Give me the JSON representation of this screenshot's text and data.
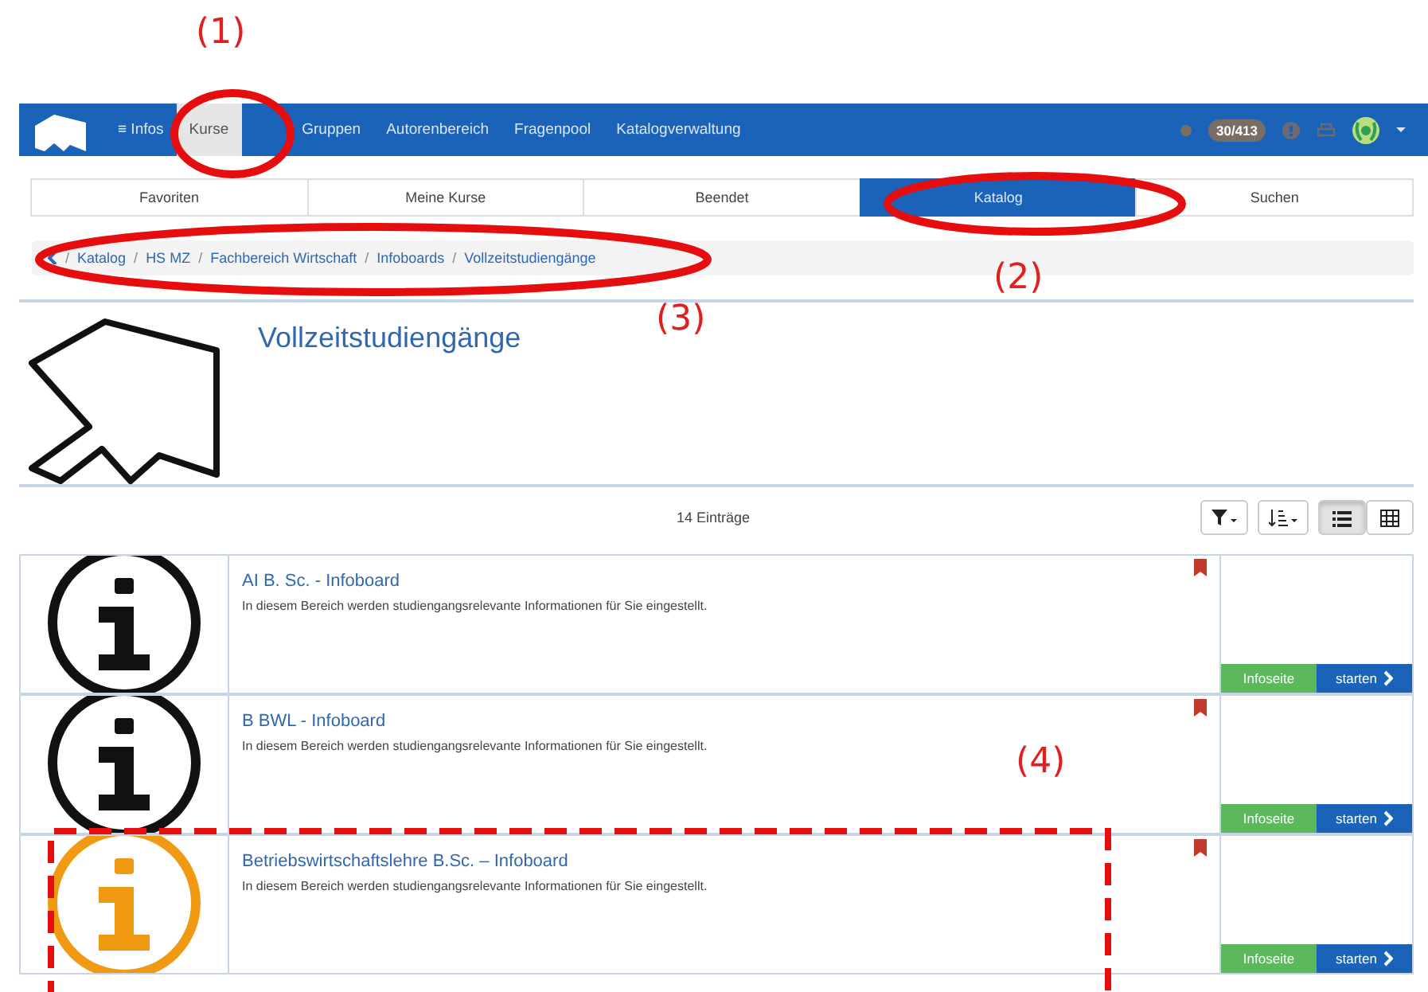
{
  "nav": {
    "items": [
      {
        "label": "≡ Infos",
        "selected": false
      },
      {
        "label": "Kurse",
        "selected": true
      },
      {
        "label": "Gruppen",
        "selected": false
      },
      {
        "label": "Autorenbereich",
        "selected": false
      },
      {
        "label": "Fragenpool",
        "selected": false
      },
      {
        "label": "Katalogverwaltung",
        "selected": false
      }
    ],
    "badge": "30/413"
  },
  "tabs": [
    {
      "label": "Favoriten",
      "selected": false
    },
    {
      "label": "Meine Kurse",
      "selected": false
    },
    {
      "label": "Beendet",
      "selected": false
    },
    {
      "label": "Katalog",
      "selected": true
    },
    {
      "label": "Suchen",
      "selected": false
    }
  ],
  "breadcrumb": [
    "Katalog",
    "HS MZ",
    "Fachbereich Wirtschaft",
    "Infoboards",
    "Vollzeitstudiengänge"
  ],
  "breadcrumb_separator": "/",
  "title": "Vollzeitstudiengänge",
  "count": "14 Einträge",
  "views": [
    {
      "kind": "list",
      "selected": true
    },
    {
      "kind": "table",
      "selected": false
    }
  ],
  "cards": [
    {
      "title": "AI B. Sc. - Infoboard",
      "description": "In diesem Bereich werden studiengangsrelevante Informationen für Sie eingestellt.",
      "color": "#111111",
      "info_button": "Infoseite",
      "start_button": "starten"
    },
    {
      "title": "B BWL - Infoboard",
      "description": "In diesem Bereich werden studiengangsrelevante Informationen für Sie eingestellt.",
      "color": "#111111",
      "info_button": "Infoseite",
      "start_button": "starten"
    },
    {
      "title": "Betriebswirtschaftslehre B.Sc. – Infoboard",
      "description": "In diesem Bereich werden studiengangsrelevante Informationen für Sie eingestellt.",
      "color": "#f09a13",
      "info_button": "Infoseite",
      "start_button": "starten"
    }
  ],
  "annotations": [
    {
      "kind": "ellipse",
      "label": "(1)"
    },
    {
      "kind": "ellipse",
      "label": "(2)"
    },
    {
      "kind": "ellipse",
      "label": "(3)"
    },
    {
      "kind": "dashed-box",
      "label": "(4)"
    }
  ]
}
